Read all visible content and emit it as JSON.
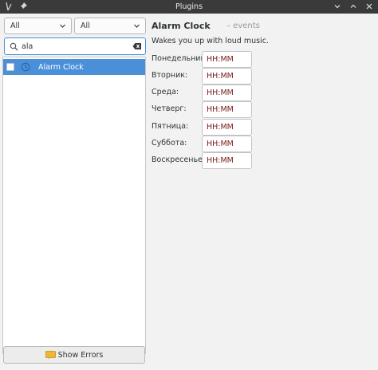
{
  "window": {
    "title": "Plugins",
    "icons": [
      "app-icon",
      "pin-icon",
      "minimize-icon",
      "maximize-icon",
      "close-icon"
    ]
  },
  "filters": {
    "left_combo": "All",
    "right_combo": "All"
  },
  "search": {
    "value": "ala",
    "icons": [
      "search-icon",
      "clear-icon"
    ]
  },
  "plugin_list": {
    "items": [
      {
        "name": "Alarm Clock",
        "checked": false,
        "icon": "clock-icon",
        "selected": true
      }
    ]
  },
  "footer": {
    "show_errors_label": "Show Errors",
    "icon": "warning-icon"
  },
  "details": {
    "name": "Alarm Clock",
    "tag": "– events",
    "description": "Wakes you up with loud music.",
    "days": [
      {
        "label": "Понедельник:",
        "value": "HH:MM"
      },
      {
        "label": "Вторник:",
        "value": "HH:MM"
      },
      {
        "label": "Среда:",
        "value": "HH:MM"
      },
      {
        "label": "Четверг:",
        "value": "HH:MM"
      },
      {
        "label": "Пятница:",
        "value": "HH:MM"
      },
      {
        "label": "Суббота:",
        "value": "HH:MM"
      },
      {
        "label": "Воскресенье:",
        "value": "HH:MM"
      }
    ]
  },
  "colors": {
    "selection": "#4a90d9",
    "titlebar": "#3a3a3a",
    "time_text": "#7b1a1a",
    "window_bg": "#f2f2f2"
  }
}
